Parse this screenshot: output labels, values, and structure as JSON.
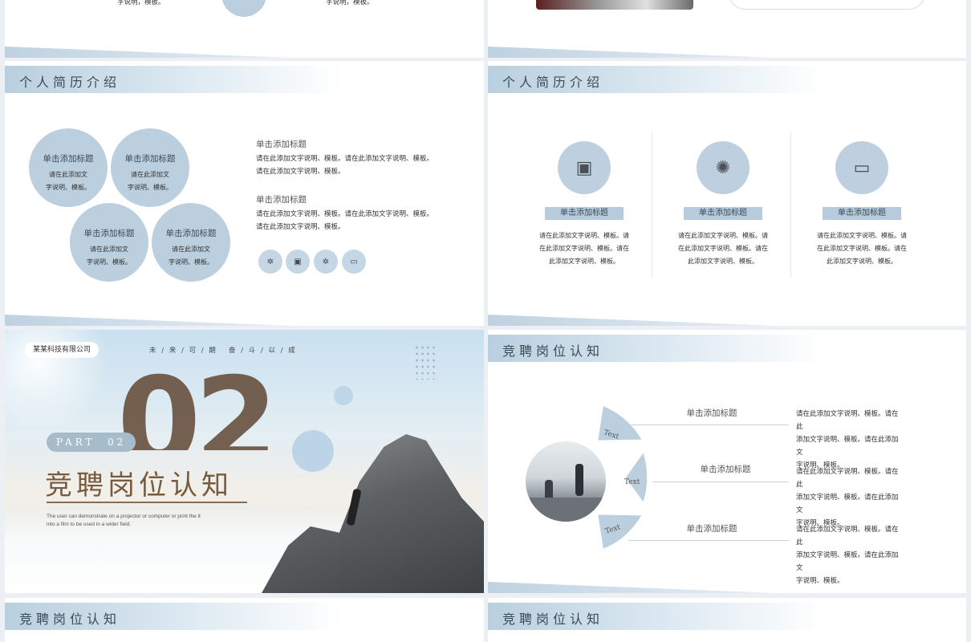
{
  "top_left": {
    "desc_a": "字说明，模板。",
    "desc_b": "字说明，模板。"
  },
  "resume_left": {
    "header": "个人简历介绍",
    "circles": [
      {
        "title": "单击添加标题",
        "desc": "请在此添加文\n字说明、模板。"
      },
      {
        "title": "单击添加标题",
        "desc": "请在此添加文\n字说明、模板。"
      },
      {
        "title": "单击添加标题",
        "desc": "请在此添加文\n字说明、模板。"
      },
      {
        "title": "单击添加标题",
        "desc": "请在此添加文\n字说明、模板。"
      }
    ],
    "texts": [
      {
        "title": "单击添加标题",
        "desc": "请在此添加文字说明、模板。请在此添加文字说明、模板。\n请在此添加文字说明、模板。"
      },
      {
        "title": "单击添加标题",
        "desc": "请在此添加文字说明、模板。请在此添加文字说明、模板。\n请在此添加文字说明、模板。"
      }
    ],
    "icons": [
      "gear-icon",
      "safe-icon",
      "atom-icon",
      "presentation-icon"
    ]
  },
  "resume_right": {
    "header": "个人简历介绍",
    "columns": [
      {
        "icon": "safe-icon",
        "label": "单击添加标题",
        "desc": "请在此添加文字说明、模板。请\n在此添加文字说明、模板。请在\n此添加文字说明、模板。"
      },
      {
        "icon": "atom-icon",
        "label": "单击添加标题",
        "desc": "请在此添加文字说明、模板。请\n在此添加文字说明、模板。请在\n此添加文字说明、模板。"
      },
      {
        "icon": "presentation-icon",
        "label": "单击添加标题",
        "desc": "请在此添加文字说明、模板。请\n在此添加文字说明、模板。请在\n此添加文字说明、模板。"
      }
    ]
  },
  "cover": {
    "company": "某某科技有限公司",
    "slogan": "未 / 来 / 可 / 期   奋 / 斗 / 以 / 成",
    "big_number": "02",
    "part": "PART  02",
    "title": "竞聘岗位认知",
    "subtitle": "The user can demonstrate on a projector or computer or print the it\ninto a film to be used in a wider field."
  },
  "position": {
    "header": "竞聘岗位认知",
    "segments": [
      "Text",
      "Text",
      "Text"
    ],
    "items": [
      {
        "title": "单击添加标题",
        "desc": "请在此添加文字说明、模板。请在此\n添加文字说明、模板。请在此添加文\n字说明、模板。"
      },
      {
        "title": "单击添加标题",
        "desc": "请在此添加文字说明、模板。请在此\n添加文字说明、模板。请在此添加文\n字说明、模板。"
      },
      {
        "title": "单击添加标题",
        "desc": "请在此添加文字说明、模板。请在此\n添加文字说明、模板。请在此添加文\n字说明、模板。"
      }
    ]
  },
  "bottom_left": {
    "header": "竞聘岗位认知"
  },
  "bottom_right": {
    "header": "竞聘岗位认知"
  },
  "colors": {
    "accent": "#bccfde",
    "title_brown": "#7a5a3c",
    "background": "#ecf0f4"
  }
}
